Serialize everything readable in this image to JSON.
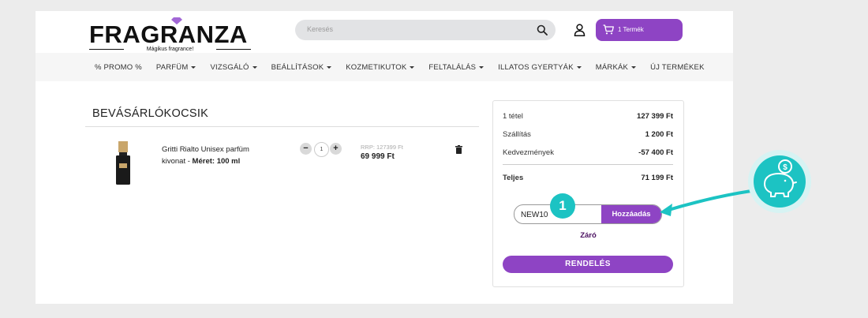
{
  "header": {
    "logo_text": "FRAGRANZA",
    "logo_tagline": "Mágikus fragrance!",
    "search_placeholder": "Keresés",
    "cart_label": "1 Termék"
  },
  "nav": {
    "items": [
      {
        "label": "% PROMO %",
        "dropdown": false
      },
      {
        "label": "PARFÜM",
        "dropdown": true
      },
      {
        "label": "VIZSGÁLÓ",
        "dropdown": true
      },
      {
        "label": "BEÁLLÍTÁSOK",
        "dropdown": true
      },
      {
        "label": "KOZMETIKUTOK",
        "dropdown": true
      },
      {
        "label": "FELTALÁLÁS",
        "dropdown": true
      },
      {
        "label": "ILLATOS GYERTYÁK",
        "dropdown": true
      },
      {
        "label": "MÁRKÁK",
        "dropdown": true
      },
      {
        "label": "ÚJ TERMÉKEK",
        "dropdown": false
      }
    ]
  },
  "cart": {
    "title": "BEVÁSÁRLÓKOCSIK",
    "item": {
      "name": "Gritti Rialto Unisex parfüm kivonat - ",
      "size_label": "Méret: 100 ml",
      "quantity": "1",
      "rrp": "RRP: 127399 Ft",
      "price": "69 999 Ft"
    }
  },
  "summary": {
    "rows": [
      {
        "label": "1 tétel",
        "value": "127 399 Ft"
      },
      {
        "label": "Szállítás",
        "value": "1 200 Ft"
      },
      {
        "label": "Kedvezmények",
        "value": "-57 400 Ft"
      }
    ],
    "total_label": "Teljes",
    "total_value": "71 199 Ft",
    "coupon_value": "NEW10",
    "coupon_button": "Hozzáadás",
    "close_link": "Záró",
    "order_button": "RENDELÉS"
  },
  "annotation": {
    "step_number": "1",
    "accent_color": "#1cc3c3"
  },
  "colors": {
    "brand_purple": "#8e44c4",
    "page_bg": "#ececec"
  }
}
